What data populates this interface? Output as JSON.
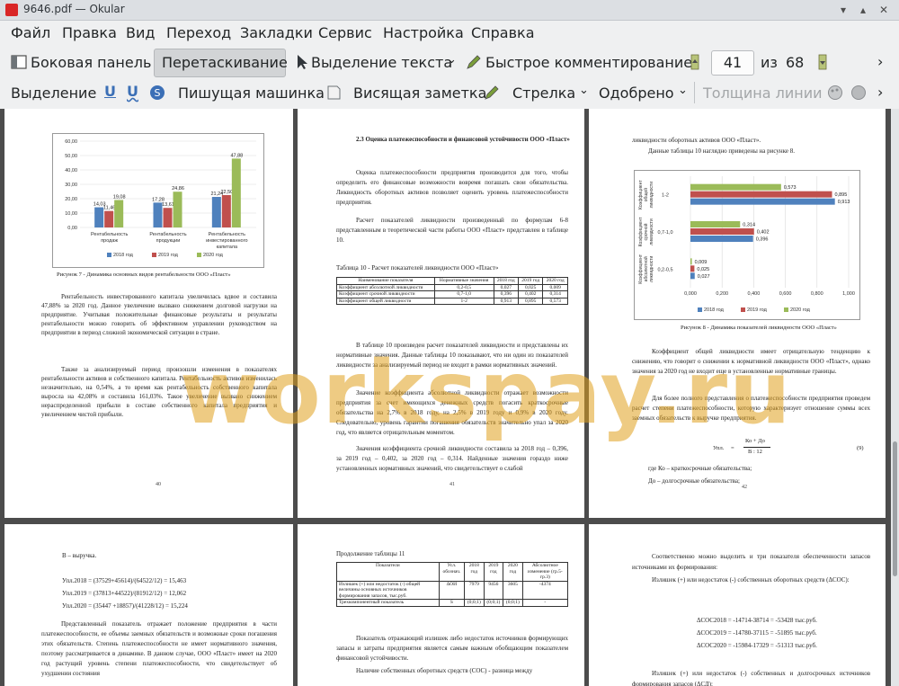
{
  "window": {
    "title": "9646.pdf  — Okular"
  },
  "menu": [
    "Файл",
    "Правка",
    "Вид",
    "Переход",
    "Закладки",
    "Сервис",
    "Настройка",
    "Справка"
  ],
  "toolbar1": {
    "sidebar": "Боковая панель",
    "drag": "Перетаскивание",
    "select_text": "Выделение текста",
    "quick_annot": "Быстрое комментирование",
    "page_current": "41",
    "of": "из",
    "page_total": "68"
  },
  "toolbar2": {
    "highlight": "Выделение",
    "typewriter": "Пишущая машинка",
    "note": "Висящая заметка",
    "arrow": "Стрелка",
    "stamp": "Одобрено",
    "line_width": "Толщина линии"
  },
  "watermark": "workspay.ru",
  "page40": {
    "caption": "Рисунок 7 - Динамика основных видов рентабельности ООО «Пласт»",
    "p1": "Рентабельность инвестированного капитала увеличилась вдвое и составила 47,88% за 2020 год. Данное увеличение вызвано снижением долговой нагрузки на предприятие. Учитывая положительные финансовые результаты и результаты рентабельности можно говорить об эффективном управлении руководством на предприятии в период сложной экономической ситуации в стране.",
    "p2": "Также за анализируемый период произошли изменения в показателях рентабельности активов и собственного капитала. Рентабельность активов изменилась незначительно, на 0,54%, а то время как рентабельность собственного капитала выросла на 42,08% и составила 161,03%. Такое увеличение вызвано снижением нераспределенной прибыли в составе собственного капитала предприятия и увеличением чистой прибыли.",
    "num": "40"
  },
  "page41": {
    "heading": "2.3 Оценка платежеспособности и финансовой устойчивости ООО «Пласт»",
    "p1": "Оценка платежеспособности предприятия производится для того, чтобы определить его финансовые возможности вовремя погашать свои обязательства. Ликвидность оборотных активов позволяет оценить уровень платежеспособности предприятия.",
    "p2": "Расчет показателей ликвидности произведенный по формулам 6-8 представленным в теоретической части работы ООО «Пласт» представлен в таблице 10.",
    "table_caption": "Таблица 10 - Расчет показателей ликвидности ООО «Пласт»",
    "table_head": [
      "Наименование показателя",
      "Нормативные значения",
      "2018 год",
      "2019 год",
      "2020 год"
    ],
    "table_rows": [
      [
        "Коэффициент абсолютной ликвидности",
        "0,2-0,5",
        "0,027",
        "0,025",
        "0,009"
      ],
      [
        "Коэффициент срочной ликвидности",
        "0,7-1,0",
        "0,396",
        "0,402",
        "0,314"
      ],
      [
        "Коэффициент общей ликвидности",
        "1-2",
        "0,913",
        "0,895",
        "0,573"
      ]
    ],
    "p3": "В таблице 10 произведен расчет показателей ликвидности и представлены их нормативные значения. Данные таблицы 10 показывают, что ни один из показателей ликвидности за анализируемый период не входит в рамки нормативных значений.",
    "p4": "Значение коэффициента абсолютной ликвидности отражает возможности предприятия за счет имеющихся денежных средств погасить краткосрочные обязательства на 2,7% в 2018 году, на 2,5% в 2019 году и 0,9% в 2020 году. Следовательно, уровень гарантии погашения обязательств значительно упал за 2020 год, что является отрицательным моментом.",
    "p5": "Значения коэффициента срочной ликвидности составила за 2018 год – 0,396, за 2019 год – 0,402, за 2020 год – 0,314. Найденные значения гораздо ниже установленных нормативных значений, что свидетельствует о слабой",
    "num": "41"
  },
  "page42": {
    "top1": "ликвидности оборотных активов ООО «Пласт».",
    "top2": "Данные таблицы 10 наглядно приведены на рисунке 8.",
    "caption": "Рисунок 8 - Динамика показателей ликвидности ООО «Пласт»",
    "p1": "Коэффициент общей ликвидности имеет отрицательную тенденцию к снижению, что говорит о снижении к нормативной ликвидности ООО «Пласт», однако значения за 2020 год не входит еще в установленные нормативные границы.",
    "p2": "Для более полного представления о платежеспособности предприятия проведем расчет степени платежеспособности, которую характеризует отношение суммы всех заемных обязательств к выручке предприятия.",
    "formula": "Упл. = (Ко + До) / (В : 12)",
    "formula_lhs": "Упл.",
    "formula_num": "Ко + До",
    "formula_den": "В : 12",
    "formula_no": "(9)",
    "where1": "где    Ко – краткосрочные обязательства;",
    "where2": "До – долгосрочные обязательства;",
    "num": "42"
  },
  "page43": {
    "l1": "В – выручка.",
    "f1": "Упл.2018 = (37529+45614)/(64522/12) = 15,463",
    "f2": "Упл.2019 = (37813+44522)/(81912/12) = 12,062",
    "f3": "Упл.2020 = (35447 +18857)/(41228/12) = 15,224",
    "p1": "Представленный показатель отражает положение предприятия в части платежеспособности, ее объемы заемных обязательств и возможные сроки погашения этих обязательств. Степень платежеспособности не имеет нормативного значения, поэтому рассматривается в динамике. В данном случае, ООО «Пласт» имеет на 2020 год растущий уровень степени платежеспособности, что свидетельствует об ухудшении состояния"
  },
  "page44": {
    "caption": "Продолжение таблицы 11",
    "table_head": [
      "Показатели",
      "Усл. обознач.",
      "2018 год",
      "2019 год",
      "2020 год",
      "Абсолютное изменение (гр.5-гр.3)"
    ],
    "table_rows": [
      [
        "Излишек (+) или недостаток (-) общей величины основных источников формирования запасов, тыс.руб.",
        "ΔОИ",
        "7979",
        "9456",
        "3605",
        "-4374"
      ],
      [
        "Трехкомпонентный показатель",
        "S",
        "(0;0;1)",
        "(0;0;1)",
        "(0;0;1)",
        "-"
      ]
    ],
    "p1": "Показатель отражающий излишек либо недостаток источников формирующих запасы и затраты предприятия является самым важным обобщающим показателем финансовой устойчивости.",
    "p2": "Наличие собственных оборотных средств (СОС) - разница между"
  },
  "page45": {
    "p1": "Соответственно можно выделить и три показателя обеспеченности запасов источниками их формирования:",
    "p2": "Излишек (+) или недостаток (-) собственных оборотных средств (ΔСОС):",
    "f1": "ΔСОС2018 = -14714-38714 = -53428 тыс.руб.",
    "f2": "ΔСОС2019 = -14780-37115 = -51895 тыс.руб.",
    "f3": "ΔСОС2020 = -15984-17329 = -51313 тыс.руб.",
    "p3": "Излишек (+) или недостаток (-) собственных и долгосрочных источников формирования запасов (ΔСД):"
  },
  "chart_data": [
    {
      "type": "bar",
      "title": "",
      "categories": [
        "Рентабельность продаж",
        "Рентабельность продукции",
        "Рентабельность инвестированного капитала"
      ],
      "series": [
        {
          "name": "2018 год",
          "color": "#4f81bd",
          "values": [
            14.03,
            17.28,
            21.24
          ]
        },
        {
          "name": "2019 год",
          "color": "#c0504d",
          "values": [
            11.46,
            13.61,
            22.5
          ]
        },
        {
          "name": "2020 год",
          "color": "#9bbb59",
          "values": [
            19.08,
            24.86,
            47.88
          ]
        }
      ],
      "ylim": [
        0,
        60
      ],
      "yticks": [
        "0,00",
        "10,00",
        "20,00",
        "30,00",
        "40,00",
        "50,00",
        "60,00"
      ],
      "value_labels": [
        [
          "14,03",
          "17,28",
          "21,24"
        ],
        [
          "11,46",
          "13,61",
          "22,50"
        ],
        [
          "19,08",
          "24,86",
          "47,88"
        ]
      ],
      "legend": "bottom"
    },
    {
      "type": "bar",
      "orientation": "horizontal",
      "title": "",
      "categories": [
        "Коэффициент общей ликвидности",
        "Коэффициент срочной ликвидности",
        "Коэффициент абсолютной ликвидности"
      ],
      "category_ranges": [
        "1-2",
        "0,7-1,0",
        "0,2-0,5"
      ],
      "series": [
        {
          "name": "2020 год",
          "color": "#9bbb59",
          "values": [
            0.573,
            0.314,
            0.009
          ]
        },
        {
          "name": "2019 год",
          "color": "#c0504d",
          "values": [
            0.895,
            0.402,
            0.025
          ]
        },
        {
          "name": "2018 год",
          "color": "#4f81bd",
          "values": [
            0.913,
            0.396,
            0.027
          ]
        }
      ],
      "value_labels": [
        [
          "0,573",
          "0,314",
          "0,009"
        ],
        [
          "0,895",
          "0,402",
          "0,025"
        ],
        [
          "0,913",
          "0,396",
          "0,027"
        ]
      ],
      "xlim": [
        0,
        1
      ],
      "xticks": [
        "0,000",
        "0,200",
        "0,400",
        "0,600",
        "0,800",
        "1,000"
      ],
      "legend": "bottom"
    }
  ]
}
